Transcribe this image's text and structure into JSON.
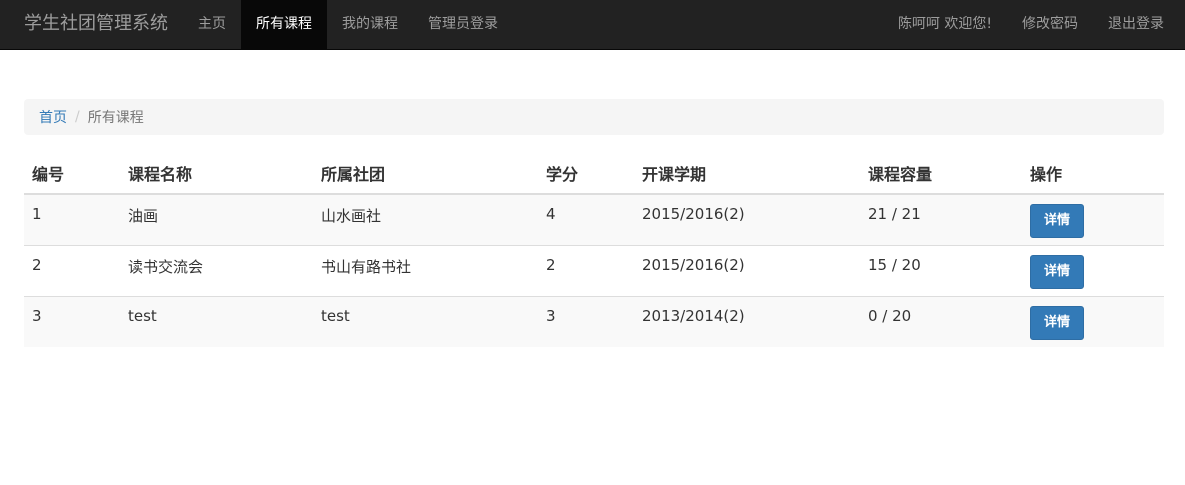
{
  "navbar": {
    "brand": "学生社团管理系统",
    "left_items": [
      {
        "label": "主页",
        "active": false
      },
      {
        "label": "所有课程",
        "active": true
      },
      {
        "label": "我的课程",
        "active": false
      },
      {
        "label": "管理员登录",
        "active": false
      }
    ],
    "right_items": [
      {
        "label": "陈呵呵 欢迎您!"
      },
      {
        "label": "修改密码"
      },
      {
        "label": "退出登录"
      }
    ],
    "colors": {
      "background": "#222222",
      "active_background": "#080808",
      "text": "#9d9d9d",
      "active_text": "#ffffff"
    }
  },
  "breadcrumb": {
    "home": "首页",
    "separator": "/",
    "current": "所有课程"
  },
  "table": {
    "headers": [
      "编号",
      "课程名称",
      "所属社团",
      "学分",
      "开课学期",
      "课程容量",
      "操作"
    ],
    "rows": [
      {
        "id": "1",
        "name": "油画",
        "club": "山水画社",
        "credit": "4",
        "term": "2015/2016(2)",
        "capacity": "21 / 21",
        "action": "详情"
      },
      {
        "id": "2",
        "name": "读书交流会",
        "club": "书山有路书社",
        "credit": "2",
        "term": "2015/2016(2)",
        "capacity": "15 / 20",
        "action": "详情"
      },
      {
        "id": "3",
        "name": "test",
        "club": "test",
        "credit": "3",
        "term": "2013/2014(2)",
        "capacity": "0 / 20",
        "action": "详情"
      }
    ]
  },
  "accent_color": "#337ab7"
}
